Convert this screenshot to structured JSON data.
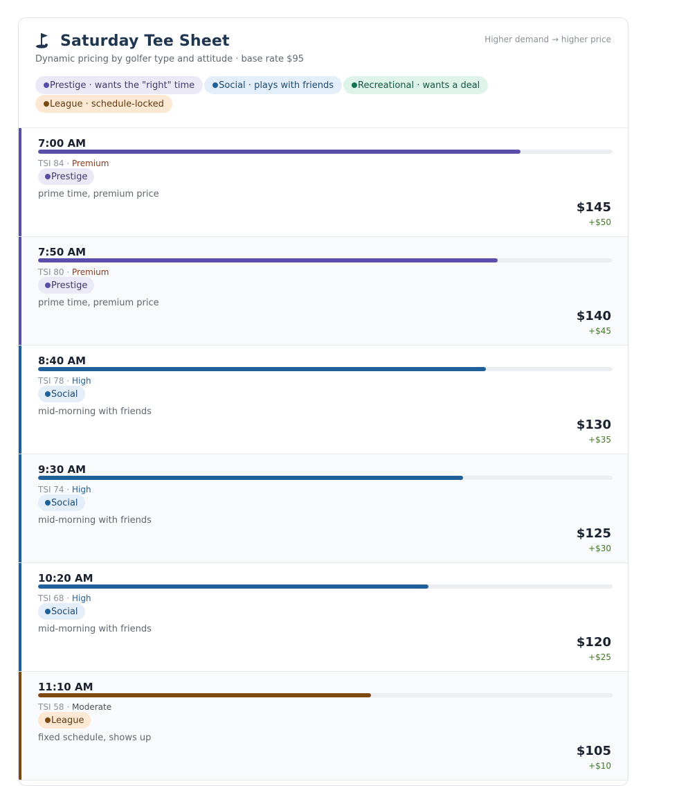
{
  "header": {
    "title": "Saturday Tee Sheet",
    "icon": "golf-flag-icon",
    "subtitle": "Dynamic pricing by golfer type and attitude  ·  base rate $95",
    "demand_note": "Higher demand  →  higher price"
  },
  "legend": [
    {
      "key": "prestige",
      "label": "Prestige · wants the \"right\" time",
      "color": "#5a4fa8"
    },
    {
      "key": "social",
      "label": "Social · plays with friends",
      "color": "#1f5f9a"
    },
    {
      "key": "rec",
      "label": "Recreational · wants a deal",
      "color": "#127552"
    },
    {
      "key": "league",
      "label": "League · schedule-locked",
      "color": "#7a4a12"
    }
  ],
  "slots": [
    {
      "time": "7:00 AM",
      "tsi_label": "TSI 84",
      "tsi": 84,
      "tier": "Premium",
      "tier_key": "premium",
      "segment": "Prestige",
      "segment_key": "prestige",
      "note": "prime time, premium price",
      "price": "$145",
      "delta": "+$50",
      "fill": 0.84
    },
    {
      "time": "7:50 AM",
      "tsi_label": "TSI 80",
      "tsi": 80,
      "tier": "Premium",
      "tier_key": "premium",
      "segment": "Prestige",
      "segment_key": "prestige",
      "note": "prime time, premium price",
      "price": "$140",
      "delta": "+$45",
      "fill": 0.8
    },
    {
      "time": "8:40 AM",
      "tsi_label": "TSI 78",
      "tsi": 78,
      "tier": "High",
      "tier_key": "high",
      "segment": "Social",
      "segment_key": "social",
      "note": "mid-morning with friends",
      "price": "$130",
      "delta": "+$35",
      "fill": 0.78
    },
    {
      "time": "9:30 AM",
      "tsi_label": "TSI 74",
      "tsi": 74,
      "tier": "High",
      "tier_key": "high",
      "segment": "Social",
      "segment_key": "social",
      "note": "mid-morning with friends",
      "price": "$125",
      "delta": "+$30",
      "fill": 0.74
    },
    {
      "time": "10:20 AM",
      "tsi_label": "TSI 68",
      "tsi": 68,
      "tier": "High",
      "tier_key": "high",
      "segment": "Social",
      "segment_key": "social",
      "note": "mid-morning with friends",
      "price": "$120",
      "delta": "+$25",
      "fill": 0.68
    },
    {
      "time": "11:10 AM",
      "tsi_label": "TSI 58",
      "tsi": 58,
      "tier": "Moderate",
      "tier_key": "moderate",
      "segment": "League",
      "segment_key": "league",
      "note": "fixed schedule, shows up",
      "price": "$105",
      "delta": "+$10",
      "fill": 0.58
    }
  ],
  "colors": {
    "prestige": "#5a4fa8",
    "social": "#1f5f9a",
    "rec": "#127552",
    "league": "#7a4a12",
    "prestige_chip_bg": "#ece9f7",
    "social_chip_bg": "#e3eef8",
    "league_chip_bg": "#fde9d3",
    "prestige_chip_text": "#3f3a6a",
    "social_chip_text": "#1d4b76",
    "league_chip_text": "#5f3a10"
  }
}
